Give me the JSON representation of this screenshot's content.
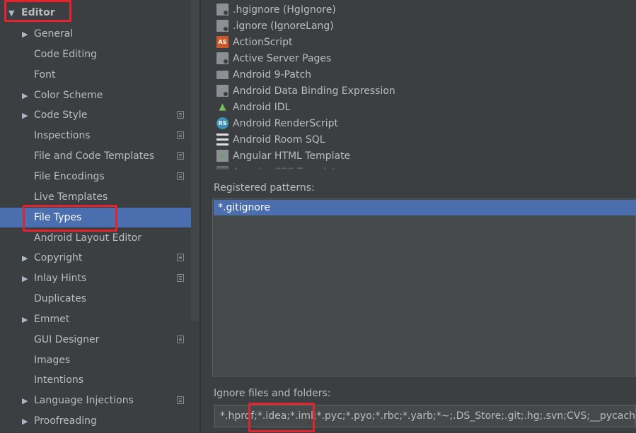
{
  "sidebar": {
    "editor_label": "Editor",
    "items": [
      {
        "label": "General",
        "expandable": true,
        "project_icon": false
      },
      {
        "label": "Code Editing",
        "expandable": false,
        "project_icon": false
      },
      {
        "label": "Font",
        "expandable": false,
        "project_icon": false
      },
      {
        "label": "Color Scheme",
        "expandable": true,
        "project_icon": false
      },
      {
        "label": "Code Style",
        "expandable": true,
        "project_icon": true
      },
      {
        "label": "Inspections",
        "expandable": false,
        "project_icon": true
      },
      {
        "label": "File and Code Templates",
        "expandable": false,
        "project_icon": true
      },
      {
        "label": "File Encodings",
        "expandable": false,
        "project_icon": true
      },
      {
        "label": "Live Templates",
        "expandable": false,
        "project_icon": false
      },
      {
        "label": "File Types",
        "expandable": false,
        "project_icon": false,
        "selected": true
      },
      {
        "label": "Android Layout Editor",
        "expandable": false,
        "project_icon": false
      },
      {
        "label": "Copyright",
        "expandable": true,
        "project_icon": true
      },
      {
        "label": "Inlay Hints",
        "expandable": true,
        "project_icon": true
      },
      {
        "label": "Duplicates",
        "expandable": false,
        "project_icon": false
      },
      {
        "label": "Emmet",
        "expandable": true,
        "project_icon": false
      },
      {
        "label": "GUI Designer",
        "expandable": false,
        "project_icon": true
      },
      {
        "label": "Images",
        "expandable": false,
        "project_icon": false
      },
      {
        "label": "Intentions",
        "expandable": false,
        "project_icon": false
      },
      {
        "label": "Language Injections",
        "expandable": true,
        "project_icon": true
      },
      {
        "label": "Proofreading",
        "expandable": true,
        "project_icon": false
      }
    ]
  },
  "file_types": [
    {
      "label": ".hgignore (HgIgnore)",
      "icon": "ignore-file-icon"
    },
    {
      "label": ".ignore (IgnoreLang)",
      "icon": "ignore-file-icon"
    },
    {
      "label": "ActionScript",
      "icon": "actionscript-icon"
    },
    {
      "label": "Active Server Pages",
      "icon": "file-icon"
    },
    {
      "label": "Android 9-Patch",
      "icon": "folder-icon"
    },
    {
      "label": "Android Data Binding Expression",
      "icon": "ignore-file-icon"
    },
    {
      "label": "Android IDL",
      "icon": "android-icon"
    },
    {
      "label": "Android RenderScript",
      "icon": "renderscript-icon"
    },
    {
      "label": "Android Room SQL",
      "icon": "database-icon"
    },
    {
      "label": "Angular HTML Template",
      "icon": "html-icon"
    },
    {
      "label": "Angular CSS Template",
      "icon": "file-icon"
    }
  ],
  "registered_patterns": {
    "label": "Registered patterns:",
    "items": [
      "*.gitignore"
    ]
  },
  "ignore": {
    "label": "Ignore files and folders:",
    "value": "*.hprof;*.idea;*.iml;*.pyc;*.pyo;*.rbc;*.yarb;*~;.DS_Store;.git;.hg;.svn;CVS;__pycache__;_svn;"
  },
  "colors": {
    "background": "#3c3f41",
    "selection": "#4b6eaf",
    "highlight_annotation": "#e8222c"
  }
}
